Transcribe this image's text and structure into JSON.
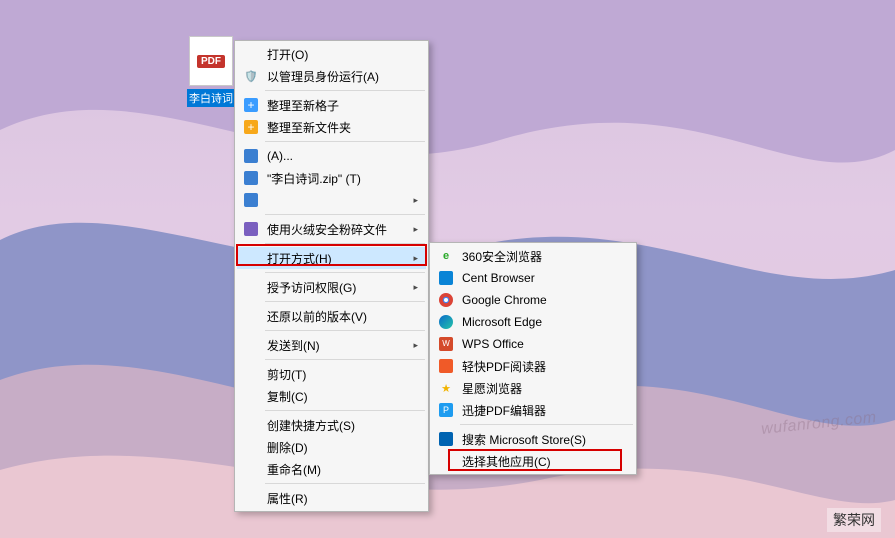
{
  "desktop_icon": {
    "badge": "PDF",
    "label": "李白诗词"
  },
  "menu1": {
    "open": "打开(O)",
    "run_as_admin": "以管理员身份运行(A)",
    "tidy_new_format": "整理至新格子",
    "tidy_new_folder": "整理至新文件夹",
    "a_ellipsis": "(A)...",
    "zip_name": "\"李白诗词.zip\" (T)",
    "empty_submenu": "",
    "shred": "使用火绒安全粉碎文件",
    "open_with": "打开方式(H)",
    "grant_access": "授予访问权限(G)",
    "restore_prev": "还原以前的版本(V)",
    "send_to": "发送到(N)",
    "cut": "剪切(T)",
    "copy": "复制(C)",
    "create_shortcut": "创建快捷方式(S)",
    "delete": "删除(D)",
    "rename": "重命名(M)",
    "properties": "属性(R)"
  },
  "menu2": {
    "browser360": "360安全浏览器",
    "cent": "Cent Browser",
    "chrome": "Google Chrome",
    "edge": "Microsoft Edge",
    "wps": "WPS Office",
    "qkpdf": "轻快PDF阅读器",
    "xingyuan": "星愿浏览器",
    "xunjie": "迅捷PDF编辑器",
    "search_store": "搜索 Microsoft Store(S)",
    "choose_other": "选择其他应用(C)"
  },
  "watermark": "wufanrong.com",
  "site_label": "繁荣网"
}
